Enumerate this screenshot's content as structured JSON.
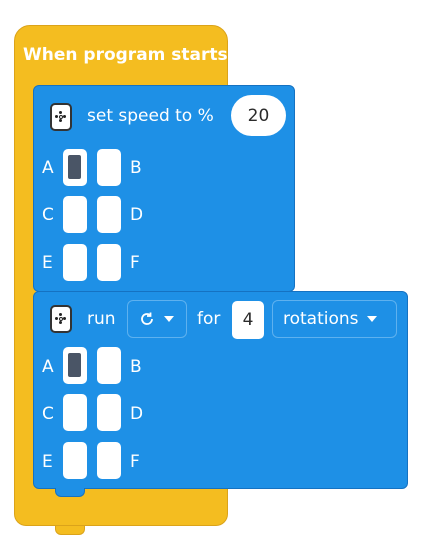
{
  "event_block": {
    "title": "When program starts"
  },
  "speed_block": {
    "label": "set speed to %",
    "value": "20",
    "ports": [
      {
        "left": "A",
        "right": "B",
        "selected_left": true
      },
      {
        "left": "C",
        "right": "D",
        "selected_left": false
      },
      {
        "left": "E",
        "right": "F",
        "selected_left": false
      }
    ]
  },
  "run_block": {
    "run_label": "run",
    "direction_icon": "rotate-clockwise-icon",
    "for_label": "for",
    "amount": "4",
    "unit": "rotations",
    "ports": [
      {
        "left": "A",
        "right": "B",
        "selected_left": true
      },
      {
        "left": "C",
        "right": "D",
        "selected_left": false
      },
      {
        "left": "E",
        "right": "F",
        "selected_left": false
      }
    ]
  },
  "colors": {
    "event": "#f4bd20",
    "motor_block": "#1e90e6",
    "port_selected": "#4a5566"
  }
}
